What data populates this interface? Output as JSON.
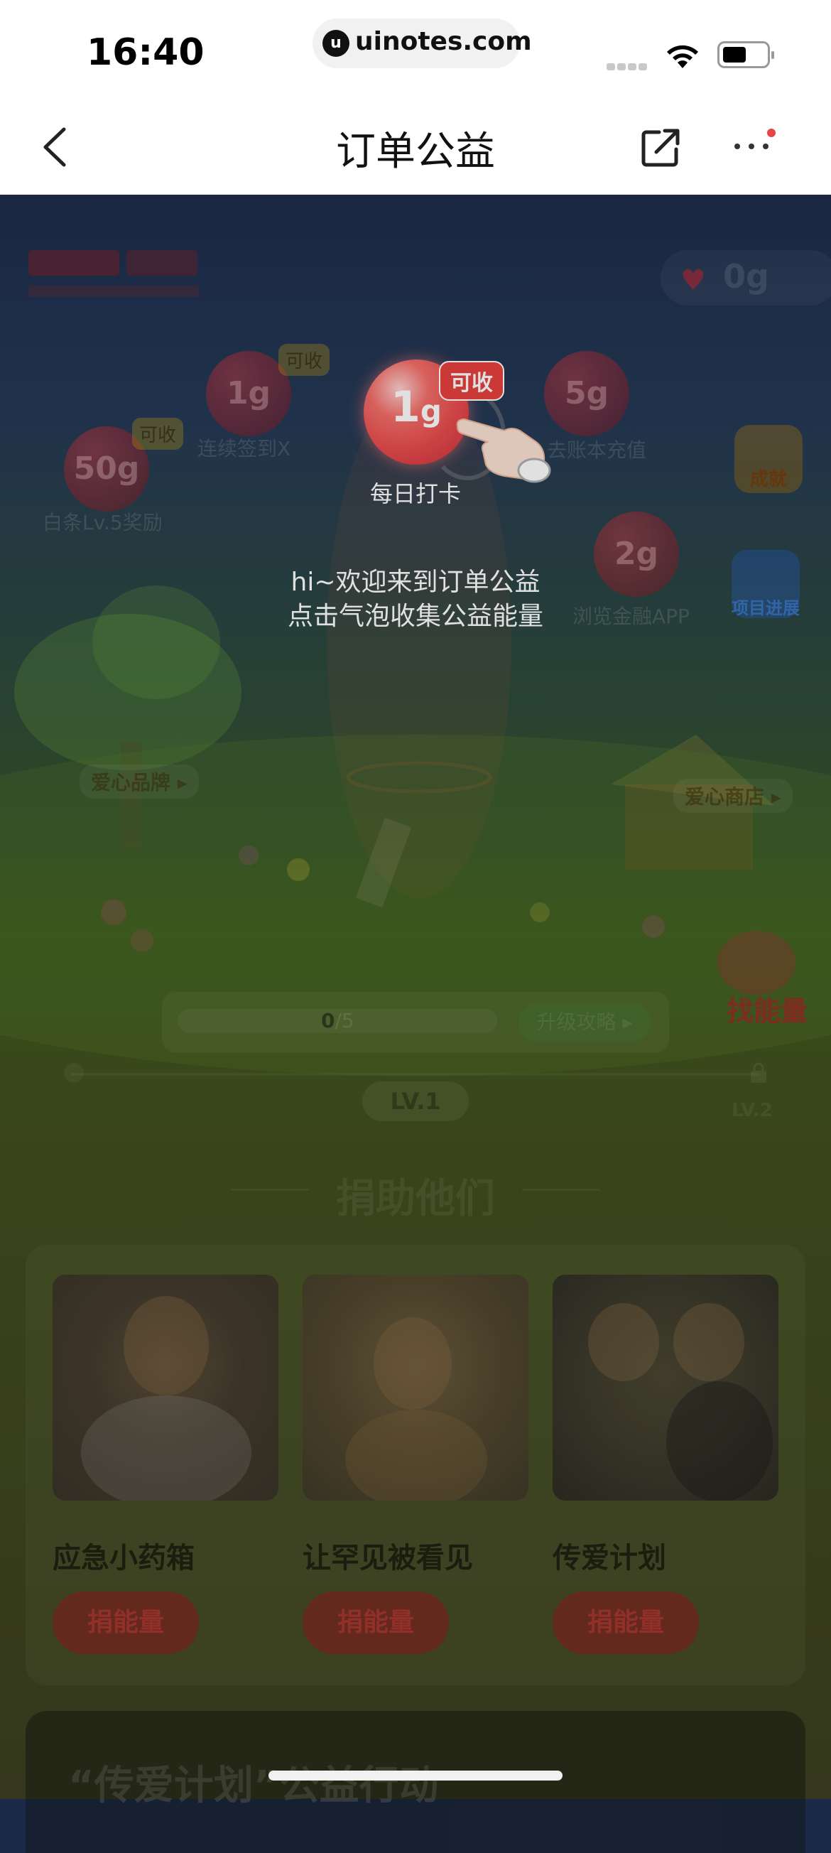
{
  "status_bar": {
    "time": "16:40",
    "url": "uinotes.com",
    "logo_glyph": "u"
  },
  "nav": {
    "title": "订单公益"
  },
  "header": {
    "energy_value": "0g"
  },
  "bubbles": [
    {
      "value": "50g",
      "label": "白条Lv.5奖励",
      "badge": "可收"
    },
    {
      "value": "1g",
      "label": "连续签到X",
      "badge": "可收"
    },
    {
      "value": "5g",
      "label": "去账本充值"
    },
    {
      "value": "2g",
      "label": "浏览金融APP"
    }
  ],
  "highlight_bubble": {
    "value": "1",
    "unit": "g",
    "badge": "可收",
    "label": "每日打卡"
  },
  "side_buttons": {
    "achievement": "成就",
    "project_progress": "项目进展",
    "find_energy": "找能量"
  },
  "scene_links": {
    "love_brand": "爱心品牌",
    "love_shop": "爱心商店"
  },
  "welcome": {
    "line1": "hi~欢迎来到订单公益",
    "line2": "点击气泡收集公益能量"
  },
  "progress": {
    "current": "0",
    "total": "/5",
    "upgrade_label": "升级攻略",
    "level_current": "LV.1",
    "level_next": "LV.2"
  },
  "donate_section": {
    "title": "捐助他们",
    "cards": [
      {
        "title": "应急小药箱",
        "button": "捐能量"
      },
      {
        "title": "让罕见被看见",
        "button": "捐能量"
      },
      {
        "title": "传爱计划",
        "button": "捐能量"
      }
    ]
  },
  "banner": {
    "text": "“传爱计划”公益行动"
  },
  "colors": {
    "accent_red": "#e8413e",
    "nav_bg": "#ffffff",
    "notification_dot": "#e54545"
  }
}
